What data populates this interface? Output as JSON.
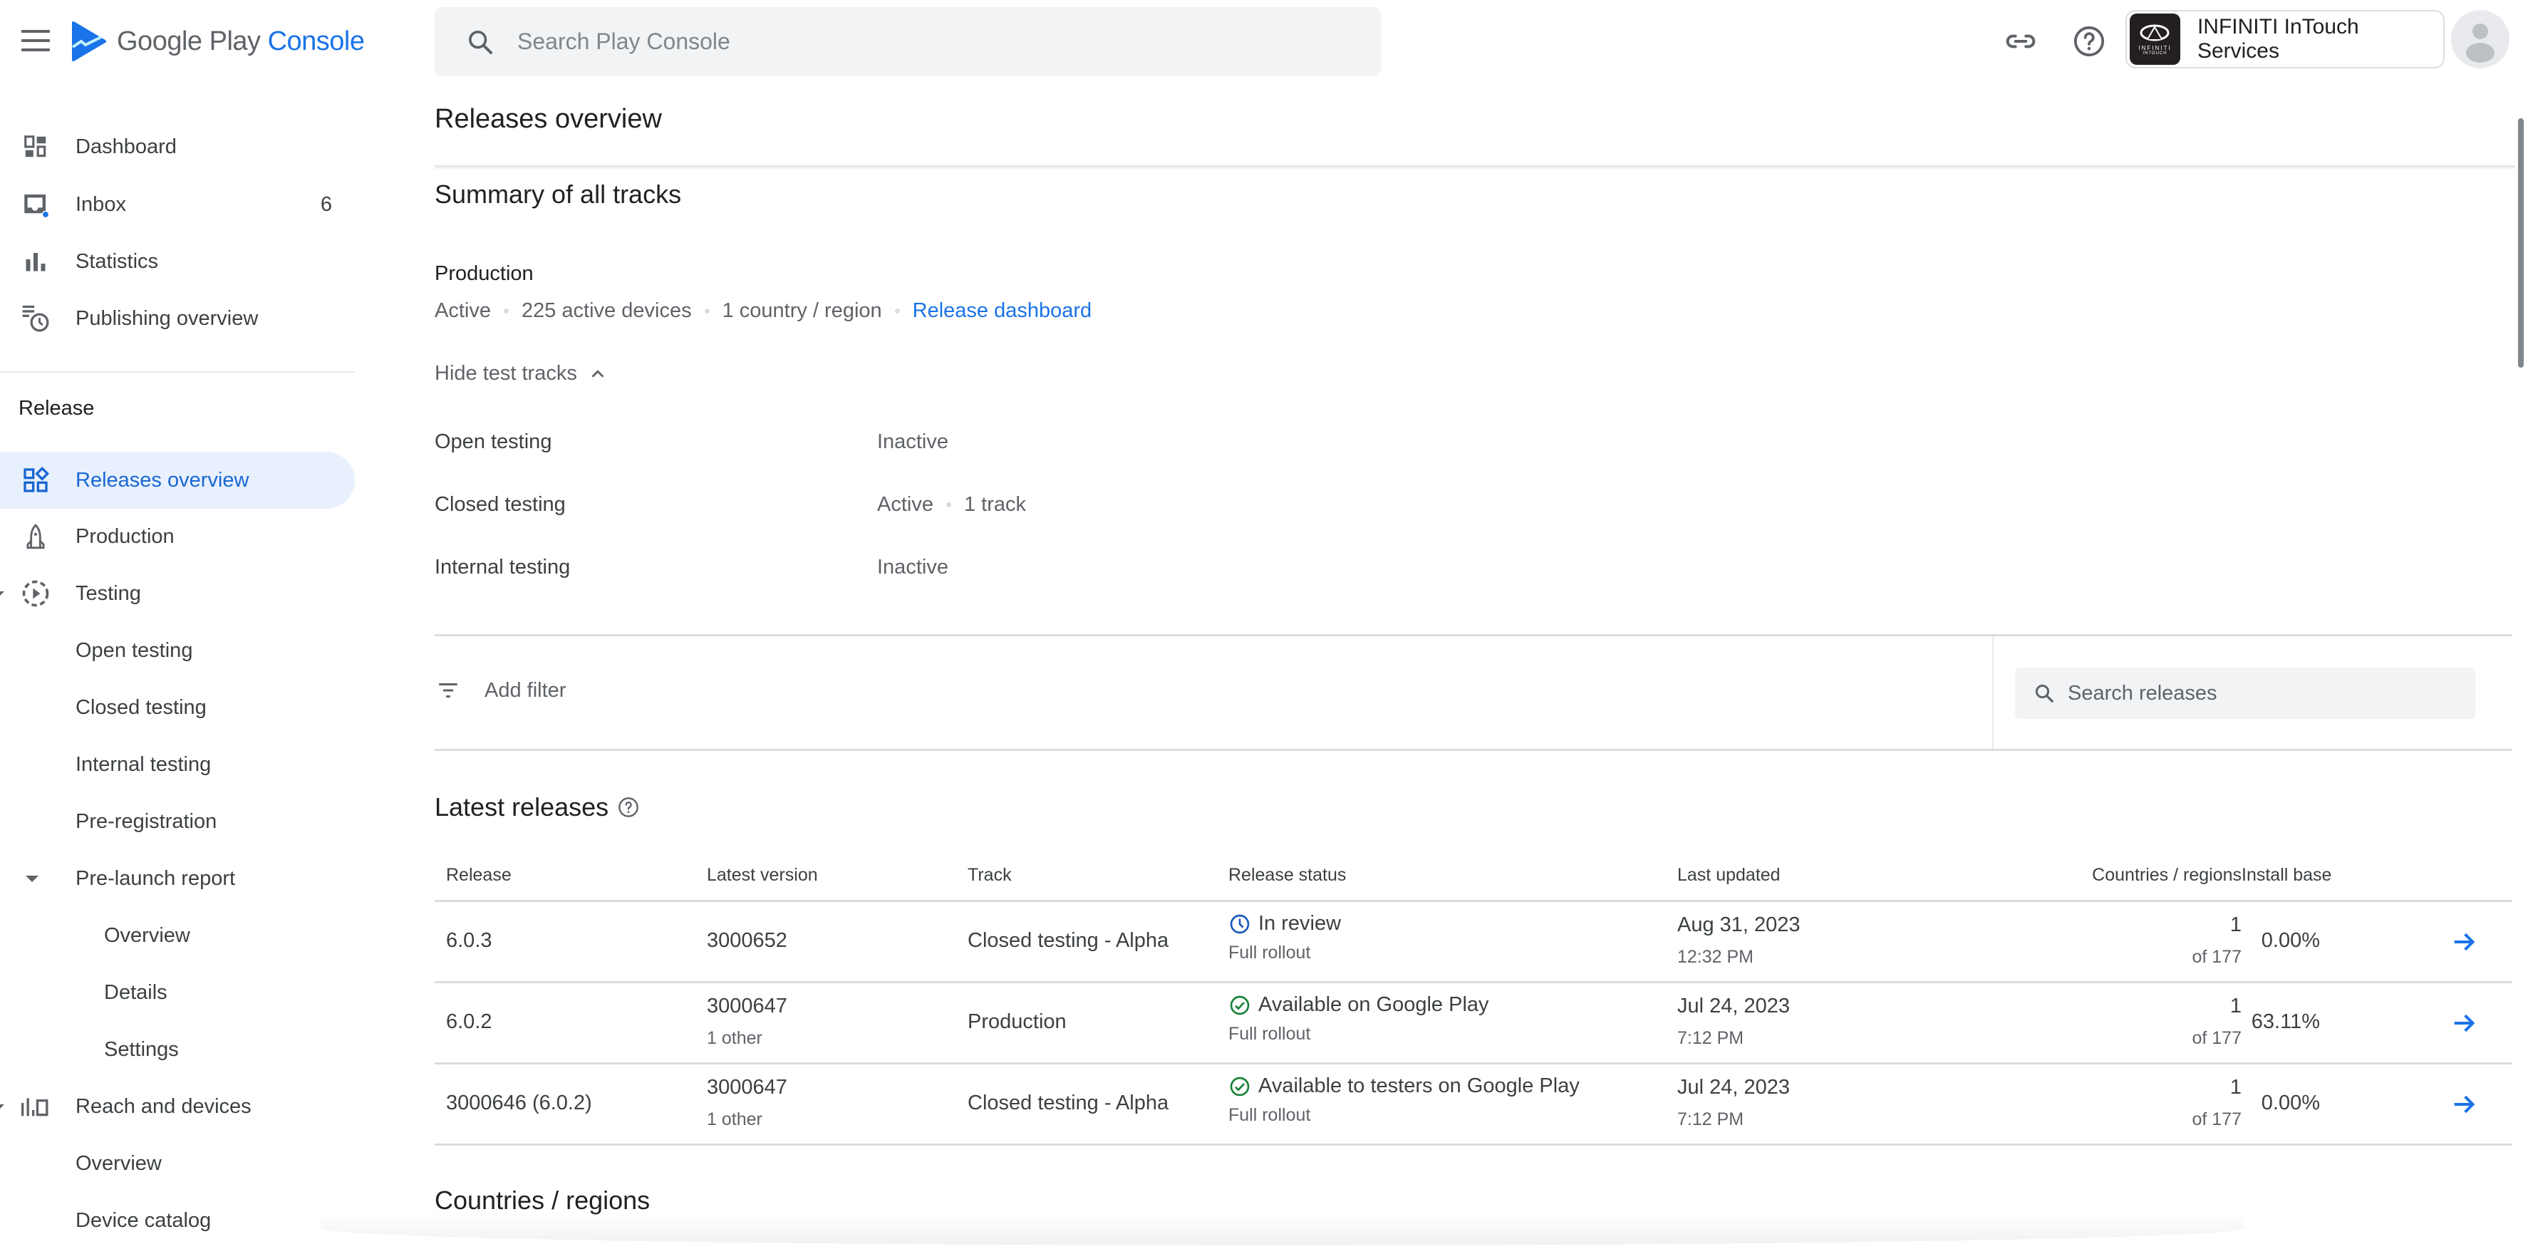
{
  "app": {
    "logo_prefix": "Google Play ",
    "logo_accent": "Console",
    "accent_color": "#1a73e8"
  },
  "topbar": {
    "search_placeholder": "Search Play Console",
    "icons": [
      "link-icon",
      "help-icon"
    ],
    "app_name": "INFINITI InTouch Services",
    "app_logo_brand": "INFINITI",
    "app_logo_sub": "INTOUCH"
  },
  "sidebar": {
    "primary": [
      {
        "label": "Dashboard",
        "icon": "dashboard-icon"
      },
      {
        "label": "Inbox",
        "icon": "inbox-icon",
        "badge": "6"
      },
      {
        "label": "Statistics",
        "icon": "bar-chart-icon"
      },
      {
        "label": "Publishing overview",
        "icon": "publishing-schedule-icon"
      }
    ],
    "section_label": "Release",
    "release_items": [
      {
        "label": "Releases overview",
        "icon": "releases-overview-icon",
        "active": true
      },
      {
        "label": "Production",
        "icon": "rocket-icon"
      },
      {
        "label": "Testing",
        "icon": "testing-play-icon"
      },
      {
        "label": "Open testing"
      },
      {
        "label": "Closed testing"
      },
      {
        "label": "Internal testing"
      },
      {
        "label": "Pre-registration"
      },
      {
        "label": "Pre-launch report",
        "expanded": true
      },
      {
        "label": "Overview"
      },
      {
        "label": "Details"
      },
      {
        "label": "Settings"
      },
      {
        "label": "Reach and devices",
        "icon": "reach-devices-icon"
      },
      {
        "label": "Overview"
      },
      {
        "label": "Device catalog"
      }
    ]
  },
  "main": {
    "page_title": "Releases overview",
    "summary": {
      "title": "Summary of all tracks",
      "production": {
        "label": "Production",
        "status": "Active",
        "devices": "225 active devices",
        "countries": "1 country / region",
        "link": "Release dashboard"
      },
      "toggle_label": "Hide test tracks",
      "test_tracks": [
        {
          "name": "Open testing",
          "status": "Inactive",
          "extra": ""
        },
        {
          "name": "Closed testing",
          "status": "Active",
          "extra": "1 track"
        },
        {
          "name": "Internal testing",
          "status": "Inactive",
          "extra": ""
        }
      ]
    },
    "filter": {
      "add_filter_label": "Add filter",
      "search_placeholder": "Search releases"
    },
    "latest_releases": {
      "title": "Latest releases",
      "columns": [
        "Release",
        "Latest version",
        "Track",
        "Release status",
        "Last updated",
        "Countries / regions",
        "Install base"
      ],
      "rows": [
        {
          "release": "6.0.3",
          "version": "3000652",
          "version_extra": "",
          "track": "Closed testing - Alpha",
          "status": "In review",
          "status_type": "review",
          "rollout": "Full rollout",
          "date": "Aug 31, 2023",
          "time": "12:32 PM",
          "countries": "1",
          "countries_total": "of 177",
          "install_base": "0.00%"
        },
        {
          "release": "6.0.2",
          "version": "3000647",
          "version_extra": "1 other",
          "track": "Production",
          "status": "Available on Google Play",
          "status_type": "available",
          "rollout": "Full rollout",
          "date": "Jul 24, 2023",
          "time": "7:12 PM",
          "countries": "1",
          "countries_total": "of 177",
          "install_base": "63.11%"
        },
        {
          "release": "3000646 (6.0.2)",
          "version": "3000647",
          "version_extra": "1 other",
          "track": "Closed testing - Alpha",
          "status": "Available to testers on Google Play",
          "status_type": "available",
          "rollout": "Full rollout",
          "date": "Jul 24, 2023",
          "time": "7:12 PM",
          "countries": "1",
          "countries_total": "of 177",
          "install_base": "0.00%"
        }
      ]
    },
    "countries_title": "Countries / regions"
  },
  "colors": {
    "review": "#185abc",
    "available": "#188038",
    "link": "#1a73e8",
    "active_nav_bg": "#e8f0fe"
  }
}
